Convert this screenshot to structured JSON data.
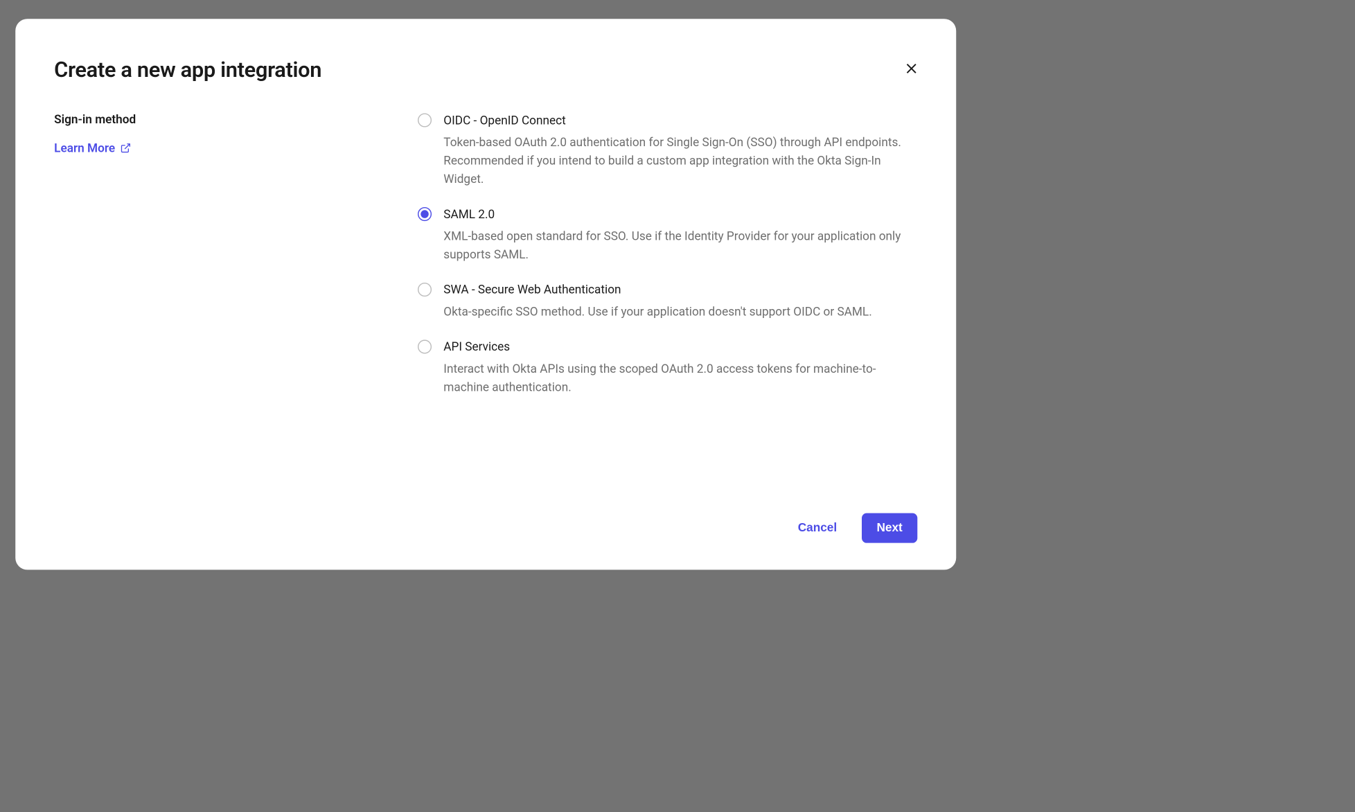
{
  "modal": {
    "title": "Create a new app integration",
    "section_label": "Sign-in method",
    "learn_more": "Learn More",
    "options": [
      {
        "title": "OIDC - OpenID Connect",
        "desc": "Token-based OAuth 2.0 authentication for Single Sign-On (SSO) through API endpoints. Recommended if you intend to build a custom app integration with the Okta Sign-In Widget.",
        "selected": false
      },
      {
        "title": "SAML 2.0",
        "desc": "XML-based open standard for SSO. Use if the Identity Provider for your application only supports SAML.",
        "selected": true
      },
      {
        "title": "SWA - Secure Web Authentication",
        "desc": "Okta-specific SSO method. Use if your application doesn't support OIDC or SAML.",
        "selected": false
      },
      {
        "title": "API Services",
        "desc": "Interact with Okta APIs using the scoped OAuth 2.0 access tokens for machine-to-machine authentication.",
        "selected": false
      }
    ],
    "cancel": "Cancel",
    "next": "Next"
  }
}
